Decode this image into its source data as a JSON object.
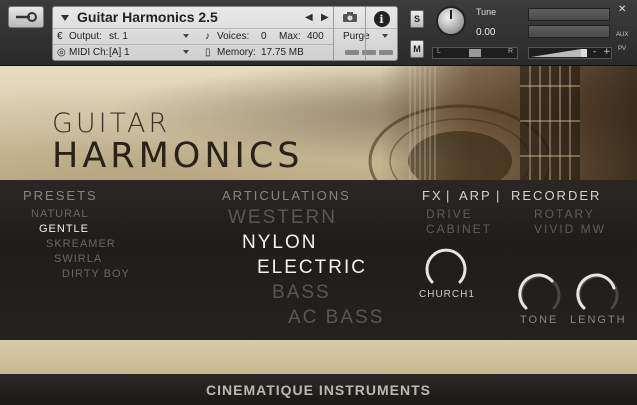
{
  "header": {
    "instrument_title": "Guitar Harmonics 2.5",
    "output_label": "Output:",
    "output_value": "st. 1",
    "voices_label": "Voices:",
    "voices_value": "0",
    "max_label": "Max:",
    "max_value": "400",
    "purge_label": "Purge",
    "midi_label": "MIDI Ch:",
    "midi_value": "[A]  1",
    "memory_label": "Memory:",
    "memory_value": "17.75 MB",
    "solo_label": "S",
    "mute_label": "M",
    "tune_label": "Tune",
    "tune_value": "0.00",
    "pan_left": "L",
    "pan_right": "R",
    "aux_label": "AUX",
    "pv_label": "PV",
    "vol_minus": "-",
    "vol_plus": "+"
  },
  "brand": {
    "line1": "GUITAR",
    "line2": "HARMONICS"
  },
  "presets": {
    "heading": "PRESETS",
    "items": [
      "NATURAL",
      "GENTLE",
      "SKREAMER",
      "SWIRLA",
      "DIRTY BOY"
    ],
    "selected": "GENTLE"
  },
  "articulations": {
    "heading": "ARTICULATIONS",
    "items": [
      "WESTERN",
      "NYLON",
      "ELECTRIC",
      "BASS",
      "AC BASS"
    ],
    "active": [
      "NYLON",
      "ELECTRIC"
    ]
  },
  "fx_tabs": {
    "fx": "FX",
    "sep1": "|",
    "arp": "ARP",
    "sep2": "|",
    "recorder": "RECORDER"
  },
  "fx_options": {
    "drive": "DRIVE",
    "rotary": "ROTARY",
    "cabinet": "CABINET",
    "vivid": "VIVID MW"
  },
  "knobs": {
    "reverb": "CHURCH1",
    "tone": "TONE",
    "length": "LENGTH"
  },
  "footer": {
    "brand": "CINEMATIQUE INSTRUMENTS"
  },
  "colors": {
    "accent_beige": "#d8cba9",
    "panel_dark": "#1f1d1b",
    "text_active": "#f4f2ee",
    "text_dim": "#5a5652"
  }
}
